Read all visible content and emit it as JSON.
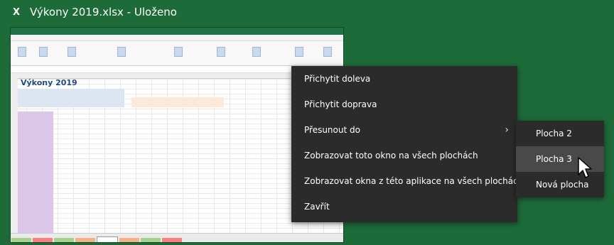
{
  "window": {
    "title": "Výkony 2019.xlsx - Uloženo",
    "app_icon": "excel-icon"
  },
  "thumbnail": {
    "sheet_title": "Výkony 2019"
  },
  "context_menu": {
    "items": [
      {
        "label": "Přichytit doleva"
      },
      {
        "label": "Přichytit doprava"
      },
      {
        "label": "Přesunout do",
        "has_submenu": true
      },
      {
        "label": "Zobrazovat toto okno na všech plochách"
      },
      {
        "label": "Zobrazovat okna z této aplikace na všech plochách"
      },
      {
        "label": "Zavřít"
      }
    ]
  },
  "submenu": {
    "items": [
      {
        "label": "Plocha 2"
      },
      {
        "label": "Plocha 3",
        "active": true
      },
      {
        "label": "Nová plocha"
      }
    ]
  },
  "colors": {
    "background": "#1e6b3a",
    "menu": "#2b2b2b",
    "menu_active": "#494949"
  }
}
